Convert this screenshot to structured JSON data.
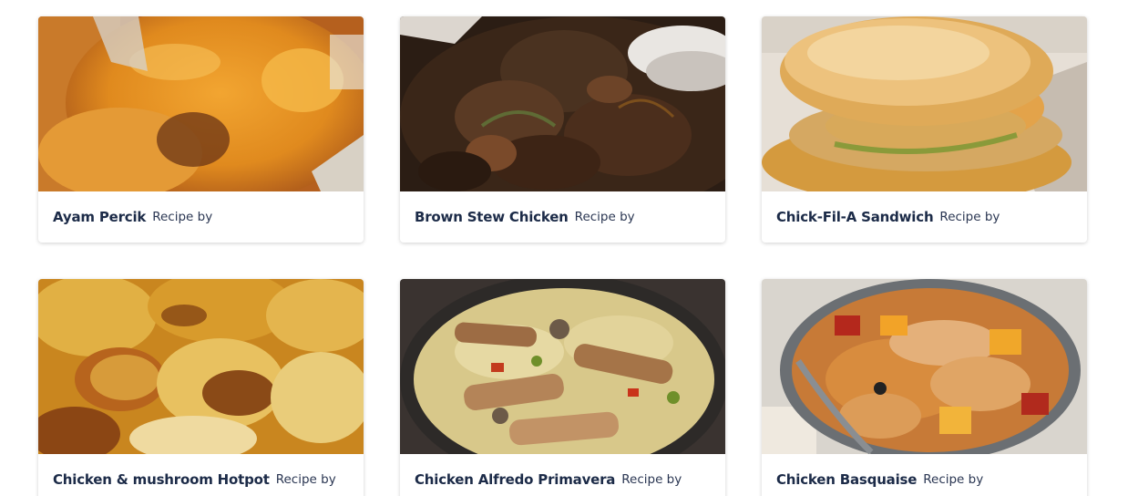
{
  "recipes": [
    {
      "title": "Ayam Percik",
      "byline": "Recipe by"
    },
    {
      "title": "Brown Stew Chicken",
      "byline": "Recipe by"
    },
    {
      "title": "Chick-Fil-A Sandwich",
      "byline": "Recipe by"
    },
    {
      "title": "Chicken & mushroom Hotpot",
      "byline": "Recipe by"
    },
    {
      "title": "Chicken Alfredo Primavera",
      "byline": "Recipe by"
    },
    {
      "title": "Chicken Basquaise",
      "byline": "Recipe by"
    }
  ]
}
